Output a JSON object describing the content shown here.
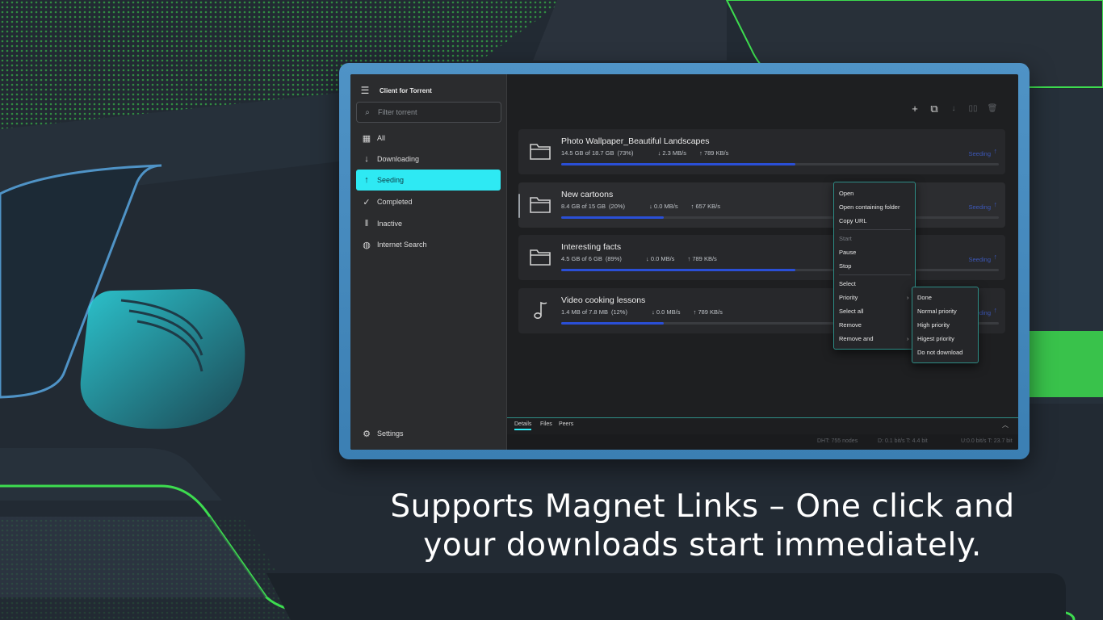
{
  "app": {
    "title": "Client for Torrent",
    "menu_icon": "hamburger-icon"
  },
  "filter": {
    "placeholder": "Filter torrent",
    "icon": "search-icon"
  },
  "sidebar": {
    "items": [
      {
        "label": "All",
        "icon": "grid-icon"
      },
      {
        "label": "Downloading",
        "icon": "arrow-down-icon"
      },
      {
        "label": "Seeding",
        "icon": "arrow-up-icon",
        "active": true
      },
      {
        "label": "Completed",
        "icon": "check-icon"
      },
      {
        "label": "Inactive",
        "icon": "pause-icon"
      },
      {
        "label": "Internet Search",
        "icon": "globe-icon"
      }
    ],
    "settings": {
      "label": "Settings",
      "icon": "gear-icon"
    }
  },
  "toolbar": [
    "add-icon",
    "link-icon",
    "download-icon",
    "pause-icon",
    "delete-icon"
  ],
  "torrents": [
    {
      "name": "Photo Wallpaper_Beautiful Landscapes",
      "size": "14.5 GB of 18.7 GB",
      "percent_text": "(73%)",
      "down": "2.3 MB/s",
      "up": "789 KB/s",
      "status": "Seeding",
      "progress": 0.535,
      "icon": "folder-icon"
    },
    {
      "name": "New cartoons",
      "size": "8.4 GB of 15 GB",
      "percent_text": "(20%)",
      "down": "0.0 MB/s",
      "up": "657 KB/s",
      "status": "Seeding",
      "progress": 0.235,
      "icon": "folder-icon"
    },
    {
      "name": "Interesting facts",
      "size": "4.5 GB of 6 GB",
      "percent_text": "(89%)",
      "down": "0.0 MB/s",
      "up": "789 KB/s",
      "status": "Seeding",
      "progress": 0.535,
      "icon": "folder-icon"
    },
    {
      "name": "Video cooking lessons",
      "size": "1.4 MB of 7.8 MB",
      "percent_text": "(12%)",
      "down": "0.0 MB/s",
      "up": "789 KB/s",
      "status": "Seeding",
      "progress": 0.235,
      "icon": "music-note-icon"
    }
  ],
  "context_menu": {
    "items": [
      {
        "label": "Open"
      },
      {
        "label": "Open containing folder"
      },
      {
        "label": "Copy URL"
      },
      {
        "label": "Start",
        "disabled": true
      },
      {
        "label": "Pause"
      },
      {
        "label": "Stop"
      },
      {
        "label": "Select"
      },
      {
        "label": "Priority",
        "submenu": true
      },
      {
        "label": "Select all"
      },
      {
        "label": "Remove"
      },
      {
        "label": "Remove and",
        "submenu": true
      }
    ]
  },
  "priority_submenu": [
    "Done",
    "Normal priority",
    "High priority",
    "Higest priority",
    "Do not download"
  ],
  "bottom_tabs": [
    "Details",
    "Files",
    "Peers"
  ],
  "statusbar": {
    "dht": "DHT: 755 nodes",
    "down": "D: 0.1 bit/s T: 4.4 bit",
    "up": "U:0.0 bit/s T: 23.7 bit"
  },
  "caption": {
    "line1": "Supports Magnet Links – One click and",
    "line2": "your downloads start immediately."
  },
  "colors": {
    "accent": "#2ee9f3",
    "progress": "#2a4fd6",
    "frame": "#4f93c6",
    "green": "#3ddc4f"
  }
}
